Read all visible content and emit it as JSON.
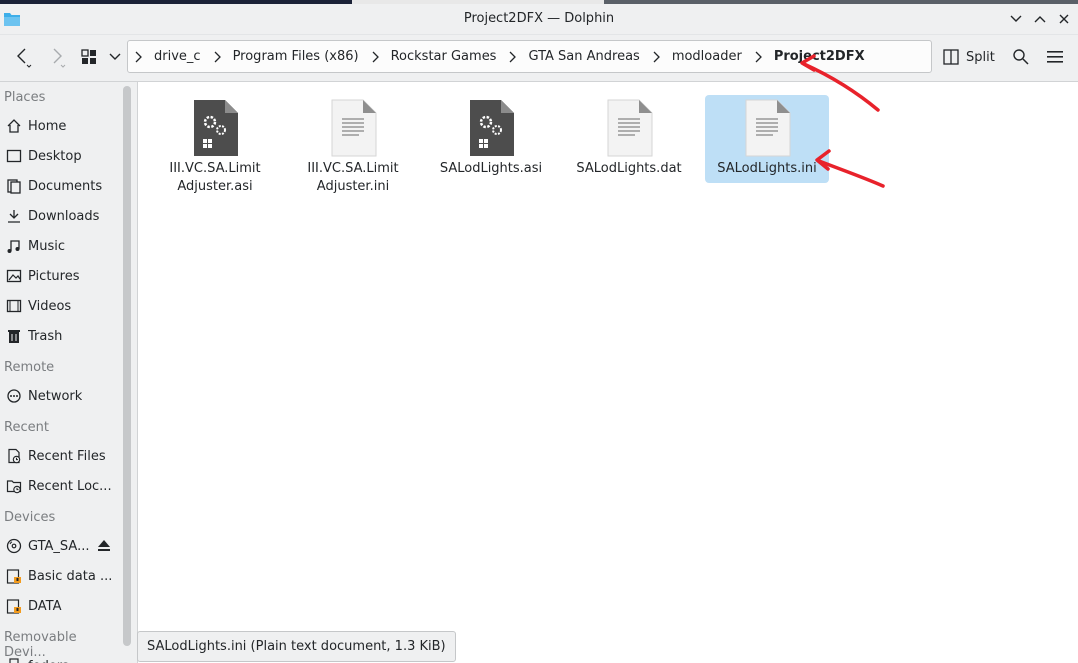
{
  "window": {
    "title": "Project2DFX — Dolphin"
  },
  "toolbar": {
    "back_icon": "chevron-left-icon",
    "forward_icon": "chevron-right-icon",
    "view_icon": "icon-view-grid",
    "split_label": "Split",
    "search_icon": "search-icon",
    "menu_icon": "hamburger-menu-icon"
  },
  "breadcrumb": [
    {
      "label": "drive_c"
    },
    {
      "label": "Program Files (x86)"
    },
    {
      "label": "Rockstar Games"
    },
    {
      "label": "GTA San Andreas"
    },
    {
      "label": "modloader"
    },
    {
      "label": "Project2DFX",
      "current": true
    }
  ],
  "sidebar": {
    "places_title": "Places",
    "places": [
      {
        "label": "Home",
        "icon": "home-icon"
      },
      {
        "label": "Desktop",
        "icon": "desktop-icon"
      },
      {
        "label": "Documents",
        "icon": "documents-icon"
      },
      {
        "label": "Downloads",
        "icon": "downloads-icon"
      },
      {
        "label": "Music",
        "icon": "music-icon"
      },
      {
        "label": "Pictures",
        "icon": "pictures-icon"
      },
      {
        "label": "Videos",
        "icon": "videos-icon"
      },
      {
        "label": "Trash",
        "icon": "trash-icon"
      }
    ],
    "remote_title": "Remote",
    "remote": [
      {
        "label": "Network",
        "icon": "network-icon"
      }
    ],
    "recent_title": "Recent",
    "recent": [
      {
        "label": "Recent Files",
        "icon": "recent-files-icon"
      },
      {
        "label": "Recent Loc...",
        "icon": "recent-locations-icon"
      }
    ],
    "devices_title": "Devices",
    "devices": [
      {
        "label": "GTA_SA...",
        "icon": "disc-icon"
      },
      {
        "label": "Basic data ...",
        "icon": "drive-icon"
      },
      {
        "label": "DATA",
        "icon": "drive-icon"
      }
    ],
    "removable_title": "Removable Devi...",
    "removable": [
      {
        "label": "fedora",
        "icon": "usb-drive-icon"
      }
    ]
  },
  "files": [
    {
      "name_line1": "III.VC.SA.Limit",
      "name_line2": "Adjuster.asi",
      "type": "executable",
      "selected": false
    },
    {
      "name_line1": "III.VC.SA.Limit",
      "name_line2": "Adjuster.ini",
      "type": "text",
      "selected": false
    },
    {
      "name_line1": "SALodLights.asi",
      "name_line2": "",
      "type": "executable",
      "selected": false
    },
    {
      "name_line1": "SALodLights.dat",
      "name_line2": "",
      "type": "text",
      "selected": false
    },
    {
      "name_line1": "SALodLights.ini",
      "name_line2": "",
      "type": "text",
      "selected": true
    }
  ],
  "statusbar": {
    "text": "SALodLights.ini (Plain text document, 1.3 KiB)"
  },
  "colors": {
    "selection": "#bedff6",
    "annotation_arrow": "#e8222b",
    "window_bg": "#eff0f1"
  }
}
